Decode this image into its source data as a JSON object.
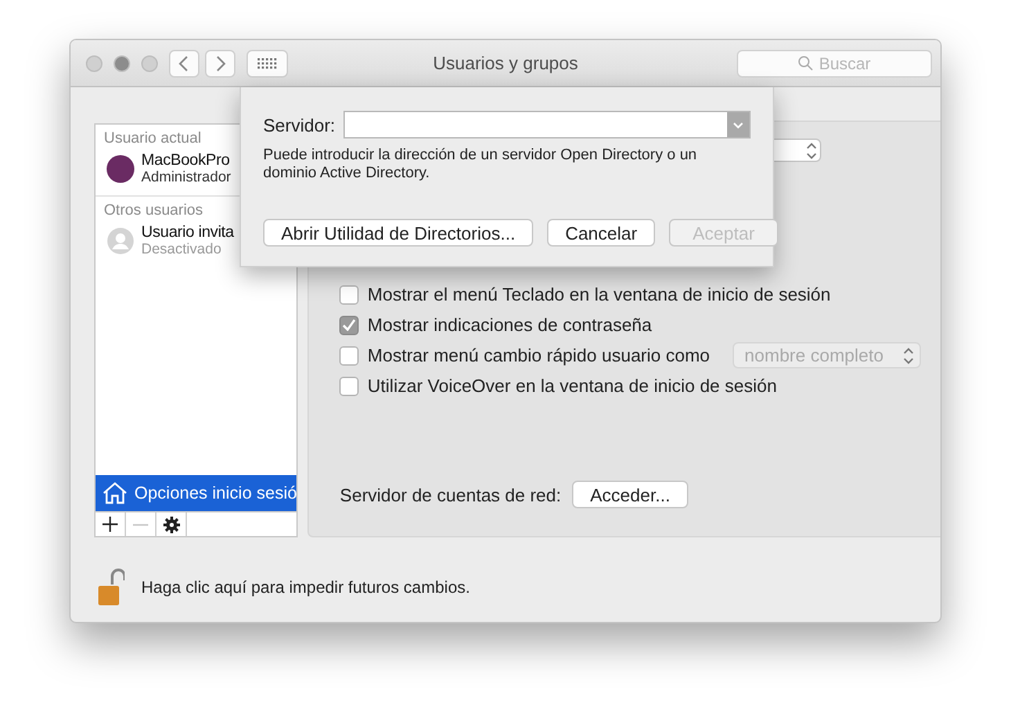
{
  "window": {
    "title": "Usuarios y grupos"
  },
  "search": {
    "placeholder": "Buscar"
  },
  "sidebar": {
    "sections": [
      {
        "heading": "Usuario actual",
        "users": [
          {
            "name": "MacBookPro",
            "role": "Administrador",
            "kind": "admin",
            "selected": false
          }
        ]
      },
      {
        "heading": "Otros usuarios",
        "users": [
          {
            "name": "Usuario invita",
            "role": "Desactivado",
            "kind": "guest",
            "selected": false
          }
        ]
      }
    ],
    "login_options": {
      "label": "Opciones inicio sesió",
      "selected": true
    },
    "footer": [
      {
        "kind": "add",
        "disabled": false
      },
      {
        "kind": "remove",
        "disabled": true
      },
      {
        "kind": "gear",
        "disabled": false
      }
    ]
  },
  "panel": {
    "options": [
      {
        "label": "Mostrar el menú Teclado en la ventana de inicio de sesión",
        "checked": false
      },
      {
        "label": "Mostrar indicaciones de contraseña",
        "checked": true
      },
      {
        "label": "Mostrar menú cambio rápido usuario como",
        "checked": false,
        "select": {
          "value": "nombre completo",
          "disabled": true
        }
      },
      {
        "label": "Utilizar VoiceOver en la ventana de inicio de sesión",
        "checked": false
      }
    ],
    "network": {
      "label": "Servidor de cuentas de red:",
      "button": "Acceder..."
    }
  },
  "lock": {
    "text": "Haga clic aquí para impedir futuros cambios.",
    "locked": false
  },
  "sheet": {
    "label": "Servidor:",
    "help": "Puede introducir la dirección de un servidor Open Directory o un dominio Active Directory.",
    "buttons": [
      {
        "label": "Abrir Utilidad de Directorios...",
        "disabled": false
      },
      {
        "label": "Cancelar",
        "disabled": false
      },
      {
        "label": "Aceptar",
        "disabled": true
      }
    ]
  }
}
